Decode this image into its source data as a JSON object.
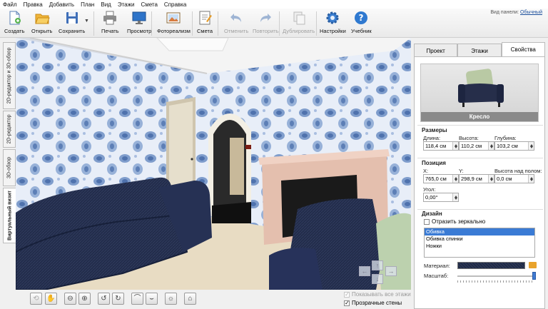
{
  "menu": [
    "Файл",
    "Правка",
    "Добавить",
    "План",
    "Вид",
    "Этажи",
    "Смета",
    "Справка"
  ],
  "toolbar": {
    "create": "Создать",
    "open": "Открыть",
    "save": "Сохранить",
    "print": "Печать",
    "preview": "Просмотр",
    "photorealism": "Фотореализм",
    "estimate": "Смета",
    "undo": "Отменить",
    "redo": "Повторить",
    "duplicate": "Дублировать",
    "settings": "Настройки",
    "tutorial": "Учебник",
    "panel_view_label": "Вид панели:",
    "panel_view_value": "Обычный"
  },
  "view_tabs": {
    "tab_2d_3d": "2D-редактор и 3D-обзор",
    "tab_2d": "2D-редактор",
    "tab_3d": "3D-обзор",
    "tab_virtual": "Виртуальный визит",
    "active": "Виртуальный визит"
  },
  "view_options": {
    "show_all_floors": "Показывать все этажи",
    "show_all_floors_checked": true,
    "show_all_floors_enabled": false,
    "transparent_walls": "Прозрачные стены",
    "transparent_walls_checked": true
  },
  "panel_tabs": {
    "project": "Проект",
    "floors": "Этажи",
    "properties": "Свойства",
    "active": "Свойства"
  },
  "properties": {
    "object_name": "Кресло",
    "dimensions": {
      "title": "Размеры",
      "length_label": "Длина:",
      "length": "118,4 см",
      "height_label": "Высота:",
      "height": "110,2 см",
      "depth_label": "Глубина:",
      "depth": "103,2 см"
    },
    "position": {
      "title": "Позиция",
      "x_label": "X:",
      "x": "765,0 см",
      "y_label": "Y:",
      "y": "298,9 см",
      "elevation_label": "Высота над полом:",
      "elevation": "0,0 см",
      "angle_label": "Угол:",
      "angle": "0,00°"
    },
    "design": {
      "title": "Дизайн",
      "mirror_label": "Отразить зеркально",
      "mirror_checked": false,
      "parts": [
        "Обивка",
        "Обивка спинки",
        "Ножки"
      ],
      "selected_part": "Обивка",
      "material_label": "Материал:",
      "scale_label": "Масштаб:",
      "scale_level": 1.0
    }
  },
  "colors": {
    "accent": "#3a7bd5",
    "sofa": "#1f2a47",
    "panel_bg": "#f0f0f0"
  }
}
